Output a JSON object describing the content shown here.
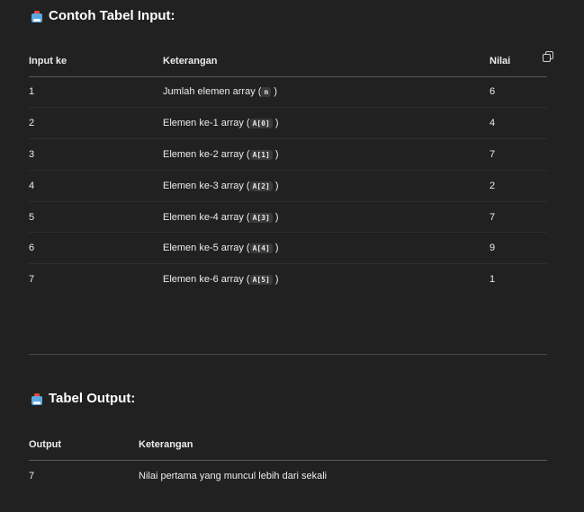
{
  "input_section": {
    "title": "Contoh Tabel Input:",
    "icon": "ballot-box-icon",
    "headers": {
      "col1": "Input ke",
      "col2": "Keterangan",
      "col3": "Nilai"
    },
    "rows": [
      {
        "no": "1",
        "desc_pre": "Jumlah elemen array (",
        "code": "n",
        "desc_post": ")",
        "value": "6"
      },
      {
        "no": "2",
        "desc_pre": "Elemen ke-1 array (",
        "code": "A[0]",
        "desc_post": ")",
        "value": "4"
      },
      {
        "no": "3",
        "desc_pre": "Elemen ke-2 array (",
        "code": "A[1]",
        "desc_post": ")",
        "value": "7"
      },
      {
        "no": "4",
        "desc_pre": "Elemen ke-3 array (",
        "code": "A[2]",
        "desc_post": ")",
        "value": "2"
      },
      {
        "no": "5",
        "desc_pre": "Elemen ke-4 array (",
        "code": "A[3]",
        "desc_post": ")",
        "value": "7"
      },
      {
        "no": "6",
        "desc_pre": "Elemen ke-5 array (",
        "code": "A[4]",
        "desc_post": ")",
        "value": "9"
      },
      {
        "no": "7",
        "desc_pre": "Elemen ke-6 array (",
        "code": "A[5]",
        "desc_post": ")",
        "value": "1"
      }
    ]
  },
  "output_section": {
    "title": "Tabel Output:",
    "icon": "ballot-box-icon",
    "headers": {
      "col1": "Output",
      "col2": "Keterangan"
    },
    "rows": [
      {
        "value": "7",
        "desc": "Nilai pertama yang muncul lebih dari sekali"
      }
    ]
  },
  "copy_icon": "copy-icon"
}
